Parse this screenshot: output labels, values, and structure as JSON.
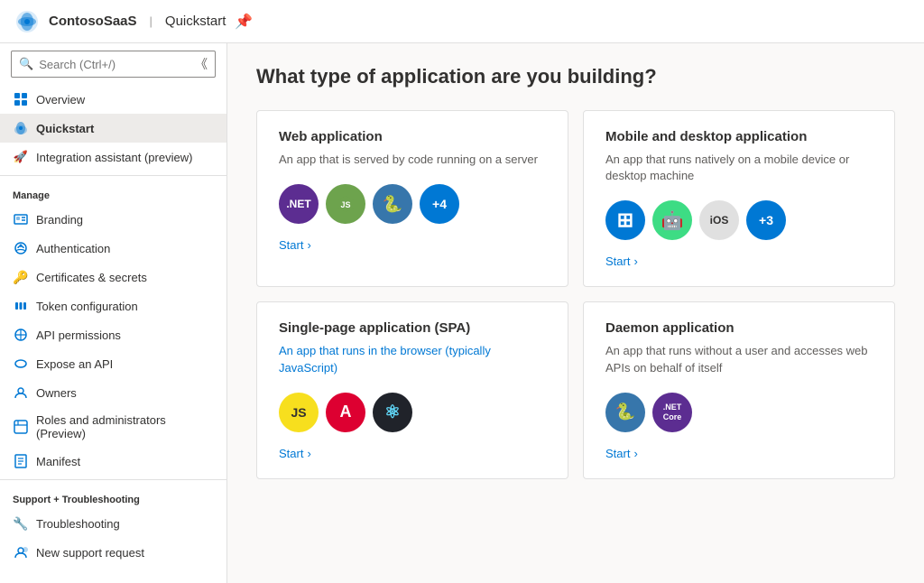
{
  "header": {
    "app_name": "ContosoSaaS",
    "divider": "|",
    "page": "Quickstart",
    "pin_label": "📌"
  },
  "sidebar": {
    "search_placeholder": "Search (Ctrl+/)",
    "items_top": [
      {
        "id": "overview",
        "label": "Overview",
        "icon": "grid"
      },
      {
        "id": "quickstart",
        "label": "Quickstart",
        "icon": "cloud",
        "active": true
      },
      {
        "id": "integration-assistant",
        "label": "Integration assistant (preview)",
        "icon": "rocket"
      }
    ],
    "section_manage": "Manage",
    "items_manage": [
      {
        "id": "branding",
        "label": "Branding",
        "icon": "branding"
      },
      {
        "id": "authentication",
        "label": "Authentication",
        "icon": "auth"
      },
      {
        "id": "certificates",
        "label": "Certificates & secrets",
        "icon": "key"
      },
      {
        "id": "token-config",
        "label": "Token configuration",
        "icon": "token"
      },
      {
        "id": "api-permissions",
        "label": "API permissions",
        "icon": "api"
      },
      {
        "id": "expose-api",
        "label": "Expose an API",
        "icon": "expose"
      },
      {
        "id": "owners",
        "label": "Owners",
        "icon": "owners"
      },
      {
        "id": "roles",
        "label": "Roles and administrators (Preview)",
        "icon": "roles"
      },
      {
        "id": "manifest",
        "label": "Manifest",
        "icon": "manifest"
      }
    ],
    "section_support": "Support + Troubleshooting",
    "items_support": [
      {
        "id": "troubleshooting",
        "label": "Troubleshooting",
        "icon": "wrench"
      },
      {
        "id": "new-support",
        "label": "New support request",
        "icon": "support"
      }
    ]
  },
  "main": {
    "title": "What type of application are you building?",
    "cards": [
      {
        "id": "web-app",
        "title": "Web application",
        "desc": "An app that is served by code running on a server",
        "icons": [
          {
            "label": ".NET",
            "bg": "#5c2d91",
            "text": ".NET"
          },
          {
            "label": "Node.js",
            "bg": "#6da34d",
            "text": "⬡"
          },
          {
            "label": "Python",
            "bg": "#3776ab",
            "text": "🐍"
          },
          {
            "label": "+4",
            "bg": "#0078d4",
            "text": "+4"
          }
        ],
        "start_label": "Start"
      },
      {
        "id": "mobile-desktop",
        "title": "Mobile and desktop application",
        "desc": "An app that runs natively on a mobile device or desktop machine",
        "icons": [
          {
            "label": "Windows",
            "bg": "#0078d4",
            "text": "⊞",
            "type": "windows"
          },
          {
            "label": "Android",
            "bg": "#3ddc84",
            "text": "🤖",
            "type": "android"
          },
          {
            "label": "iOS",
            "bg": "#e0e0e0",
            "text": "iOS",
            "textColor": "#323130"
          },
          {
            "label": "+3",
            "bg": "#0078d4",
            "text": "+3"
          }
        ],
        "start_label": "Start"
      },
      {
        "id": "spa",
        "title": "Single-page application (SPA)",
        "desc": "An app that runs in the browser (typically JavaScript)",
        "icons": [
          {
            "label": "JavaScript",
            "bg": "#f7df1e",
            "text": "JS",
            "textColor": "#323130"
          },
          {
            "label": "Angular",
            "bg": "#dd0031",
            "text": "A"
          },
          {
            "label": "React",
            "bg": "#61dafb",
            "text": "⚛",
            "textColor": "#323130"
          }
        ],
        "start_label": "Start"
      },
      {
        "id": "daemon",
        "title": "Daemon application",
        "desc": "An app that runs without a user and accesses web APIs on behalf of itself",
        "icons": [
          {
            "label": "Python",
            "bg": "#3776ab",
            "text": "🐍"
          },
          {
            "label": ".NET Core",
            "bg": "#5c2d91",
            "text": ".NET\nCore",
            "small": true
          }
        ],
        "start_label": "Start"
      }
    ]
  }
}
